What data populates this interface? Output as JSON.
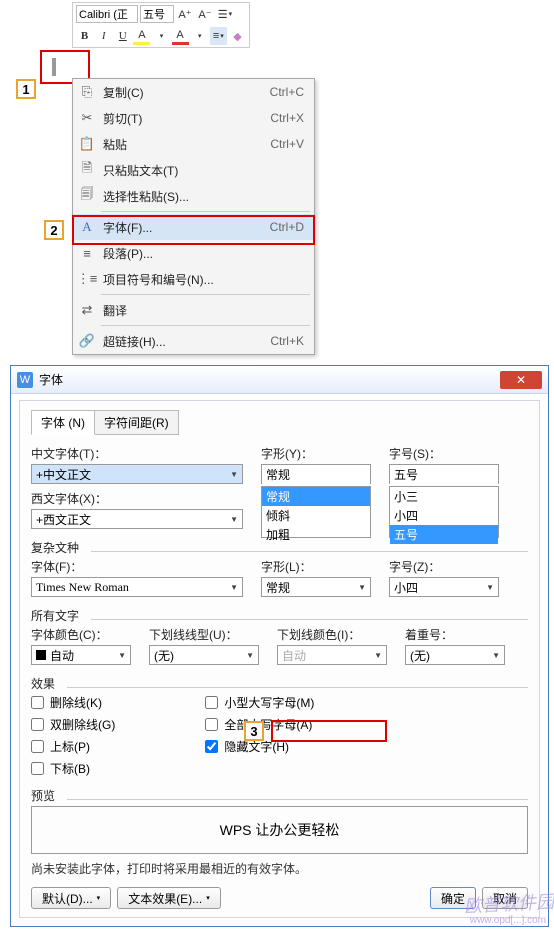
{
  "toolbar": {
    "font": "Calibri (正",
    "size": "五号",
    "inc": "A⁺",
    "dec": "A⁻",
    "b": "B",
    "i": "I",
    "u": "U",
    "hl": "A",
    "fc": "A",
    "align": "≡",
    "clear": "◆"
  },
  "callouts": {
    "c1": "1",
    "c2": "2",
    "c3": "3"
  },
  "menu": {
    "copy": {
      "label": "复制(C)",
      "short": "Ctrl+C",
      "icon": "⎘"
    },
    "cut": {
      "label": "剪切(T)",
      "short": "Ctrl+X",
      "icon": "✂"
    },
    "paste": {
      "label": "粘贴",
      "short": "Ctrl+V",
      "icon": "📋"
    },
    "paste_text": {
      "label": "只粘贴文本(T)",
      "icon": "🗎"
    },
    "paste_special": {
      "label": "选择性粘贴(S)...",
      "icon": "🗐"
    },
    "font": {
      "label": "字体(F)...",
      "short": "Ctrl+D",
      "icon": "A"
    },
    "para": {
      "label": "段落(P)...",
      "icon": "≡"
    },
    "bullets": {
      "label": "项目符号和编号(N)...",
      "icon": "⋮≡"
    },
    "translate": {
      "label": "翻译",
      "icon": "⇄"
    },
    "hyperlink": {
      "label": "超链接(H)...",
      "short": "Ctrl+K",
      "icon": "🔗"
    }
  },
  "dialog": {
    "title": "字体",
    "tabs": {
      "font": "字体 (N)",
      "spacing": "字符间距(R)"
    },
    "cn_font_label": "中文字体(T)：",
    "cn_font": "+中文正文",
    "style_label": "字形(Y)：",
    "style": "常规",
    "style_opts": [
      "常规",
      "倾斜",
      "加粗"
    ],
    "size_label": "字号(S)：",
    "size": "五号",
    "size_opts": [
      "小三",
      "小四",
      "五号"
    ],
    "west_font_label": "西文字体(X)：",
    "west_font": "+西文正文",
    "complex": "复杂文种",
    "complex_font_label": "字体(F)：",
    "complex_font": "Times New Roman",
    "complex_style_label": "字形(L)：",
    "complex_style": "常规",
    "complex_size_label": "字号(Z)：",
    "complex_size": "小四",
    "all_text": "所有文字",
    "color_label": "字体颜色(C)：",
    "color": "自动",
    "underline_label": "下划线线型(U)：",
    "underline": "(无)",
    "ul_color_label": "下划线颜色(I)：",
    "ul_color": "自动",
    "emphasis_label": "着重号：",
    "emphasis": "(无)",
    "effects": "效果",
    "strike": "删除线(K)",
    "dbl_strike": "双删除线(G)",
    "sup": "上标(P)",
    "sub": "下标(B)",
    "smallcaps": "小型大写字母(M)",
    "allcaps": "全部大写字母(A)",
    "hidden": "隐藏文字(H)",
    "preview": "预览",
    "preview_text": "WPS 让办公更轻松",
    "note": "尚未安装此字体，打印时将采用最相近的有效字体。",
    "default": "默认(D)...",
    "text_effect": "文本效果(E)...",
    "ok": "确定",
    "cancel": "取消"
  },
  "watermark": {
    "t1": "欧普软件园",
    "t2": "www.opd[...].com"
  }
}
